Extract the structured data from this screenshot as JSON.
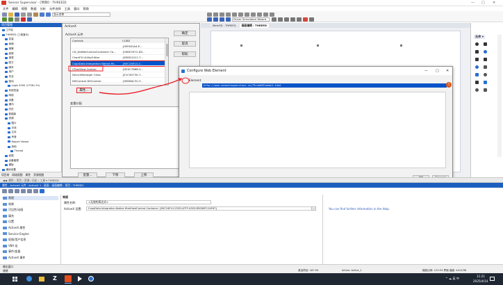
{
  "app": {
    "title": "Sensor Supervisor - [项目0 : THREED]",
    "menu": [
      "文件",
      "编辑",
      "视图",
      "数据",
      "分析",
      "元件选择",
      "工具",
      "窗口",
      "帮助"
    ],
    "window_controls": [
      "—",
      "□",
      "✕"
    ],
    "combo_value": "显示名称",
    "breadcrumb_left": "项目管理"
  },
  "toolbar_right": {
    "dropdown_value": "Driver Simulation Wizard"
  },
  "doc_tabs": [
    {
      "label": "Main3D : THREED",
      "active": false
    },
    {
      "label": "画面编辑 : THREED",
      "active": true
    }
  ],
  "tree": {
    "items": [
      {
        "label": "工作区",
        "level": 0
      },
      {
        "label": "THREED (三维演示)",
        "level": 0
      },
      {
        "label": "变量",
        "level": 1
      },
      {
        "label": "画面",
        "level": 1
      },
      {
        "label": "报警",
        "level": 1
      },
      {
        "label": "趋势",
        "level": 1
      },
      {
        "label": "报表",
        "level": 1
      },
      {
        "label": "配方",
        "level": 1
      },
      {
        "label": "脚本",
        "level": 1
      },
      {
        "label": "用户",
        "level": 1
      },
      {
        "label": "安全",
        "level": 1
      },
      {
        "label": "驱动",
        "level": 1
      },
      {
        "label": "Logix 5000 (1756-L7x)",
        "level": 2
      },
      {
        "label": "系统变量",
        "level": 1
      },
      {
        "label": "网络",
        "level": 1
      },
      {
        "label": "设备",
        "level": 1
      },
      {
        "label": "通讯",
        "level": 1
      },
      {
        "label": "历史",
        "level": 1
      },
      {
        "label": "数据库",
        "level": 1
      },
      {
        "label": "资源",
        "level": 1
      },
      {
        "label": "图片",
        "level": 2
      },
      {
        "label": "字体",
        "level": 2
      },
      {
        "label": "文本",
        "level": 2
      },
      {
        "label": "声音",
        "level": 2
      },
      {
        "label": "Report Viewer",
        "level": 2
      },
      {
        "label": "其他",
        "level": 2
      },
      {
        "label": "Thread",
        "level": 3
      },
      {
        "label": "权限",
        "level": 1
      },
      {
        "label": "设备管理",
        "level": 1
      },
      {
        "label": "模板",
        "level": 1
      },
      {
        "label": "通用设置",
        "level": 0
      }
    ],
    "bottom_tabs": [
      "项目树",
      "网络视图",
      "属性",
      "资源视图"
    ]
  },
  "activex_dialog": {
    "group_title": "ActiveX",
    "list_title": "ActiveX 元件",
    "columns": [
      "Controls",
      "CLSID"
    ],
    "rows": [
      {
        "name": "Controls",
        "clsid": "CLSID"
      },
      {
        "name": "",
        "clsid": "{0EFA91A4-E..."
      },
      {
        "name": "CD_DotNetControlContainer Co...",
        "clsid": "{09DE2972-D0..."
      },
      {
        "name": "ChartFX.Utility.Editor",
        "clsid": "{85DD1011-7..."
      },
      {
        "name": "CopaData.Integration.Native.Ht...",
        "clsid": "{80C24E14-2..."
      },
      {
        "name": "CTreeView Control",
        "clsid": "{DE0C7B6B-5..."
      },
      {
        "name": "DeviceManager Class",
        "clsid": "{E1C5D730-7..."
      },
      {
        "name": "DISControl DISControl",
        "clsid": "{9EDBAC3C-F..."
      }
    ],
    "selected_row": 4,
    "btn_ok": "确定",
    "btn_cancel": "取消",
    "btn_help": "帮助",
    "btn_properties": "属性...",
    "events_label": "变量分配",
    "btn_variables": "变量...",
    "btn_down": "下移",
    "btn_up": "上移"
  },
  "web_dialog": {
    "title": "Configure Web Element",
    "url_label": "Element",
    "url_value": "http://www.sensorsupervisor.cn/ThreeDElement.html",
    "btn_ok": "OK",
    "btn_cancel": "Cancel"
  },
  "right_panel": {
    "title": "元件 ▾"
  },
  "status_strip": {
    "text": "◀ ▶ 属性 / 项目 / 资源 / 历史 / 工具 ▾ THREED"
  },
  "props_panel": {
    "title": "属性 - ActiveX 元件 - ActiveX 1 - 画面 - 画面编辑 - 项目 : THREED",
    "left_items": [
      "常规",
      "效果",
      "可见性/动画",
      "填充",
      "位置",
      "ActiveX 属性",
      "Service Engine",
      "权限/用户信息",
      "VBA 宏",
      "事件/变量",
      "ActiveX 事件"
    ],
    "header_label": "常规",
    "field1_label": "属性名称:",
    "field1_value": "<无效的表达式>",
    "field2_label": "ActiveX 设置:",
    "field2_value": "CopaData.Integration.Native.HtmlHostControl.Container {80C24E14-252D-4FFF-A303-B50D8F12AF67}",
    "help_text": "You can find further information in the Help."
  },
  "output_tab": "输出窗口",
  "statusbar": {
    "left": "就绪",
    "mid1": "激活项目: 187:94",
    "mid2": "Active: Active_1",
    "right": "缩放比例: 123:53  界面 高度: 4412/98"
  },
  "taskbar": {
    "tray": "^ ☁ 英 中",
    "time": "11:21",
    "date": "2025/4/14"
  },
  "colors": {
    "accent": "#0078d7",
    "selection": "#0055cc",
    "annotation": "#e8222a",
    "taskbar": "#1f2733"
  }
}
